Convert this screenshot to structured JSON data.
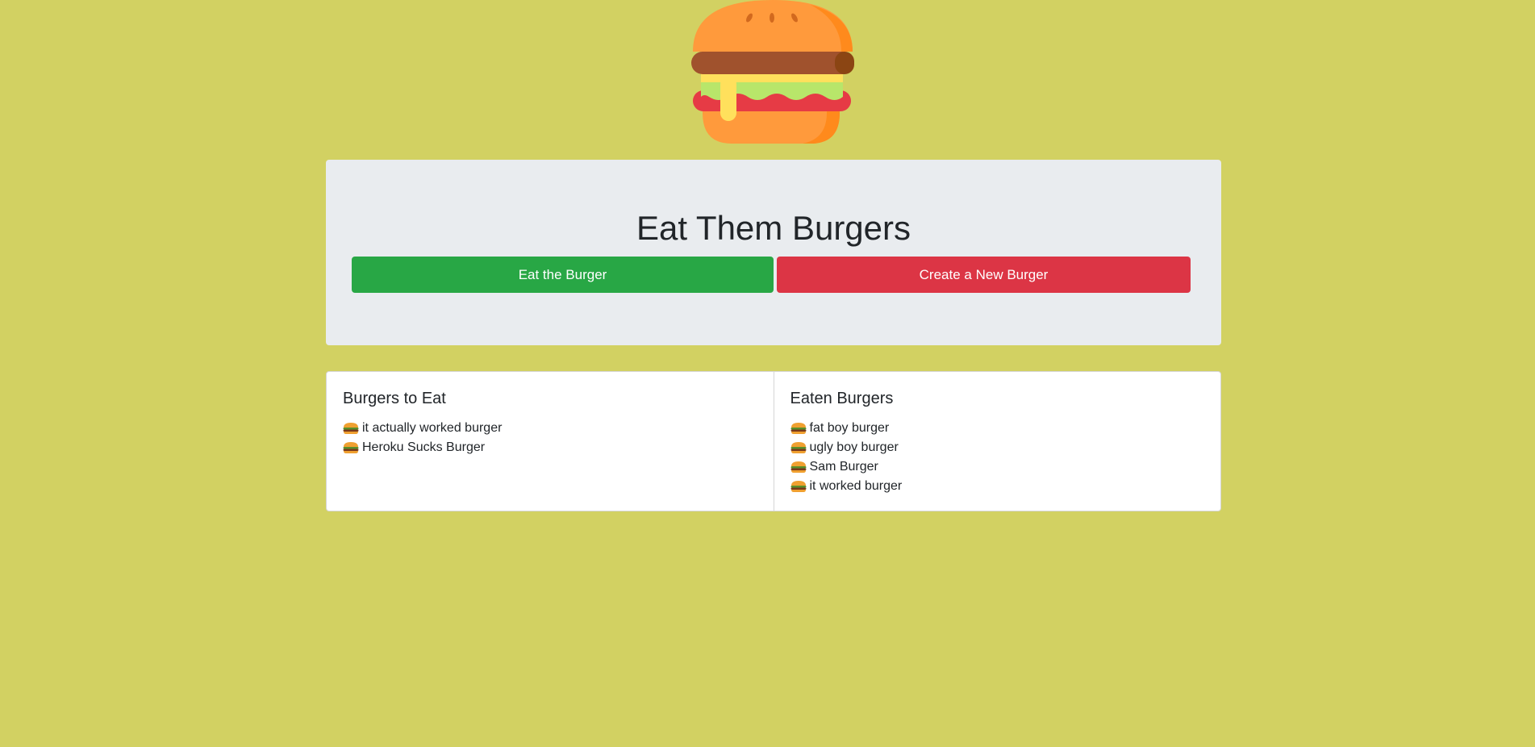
{
  "header": {
    "logo_icon": "burger-icon"
  },
  "jumbotron": {
    "title": "Eat Them Burgers",
    "eat_button_label": "Eat the Burger",
    "create_button_label": "Create a New Burger"
  },
  "colors": {
    "background": "#d2d162",
    "eat_button": "#28a745",
    "create_button": "#dc3545",
    "jumbotron": "#e9ecef"
  },
  "to_eat": {
    "title": "Burgers to Eat",
    "items": [
      {
        "icon": "burger-icon",
        "name": "it actually worked burger"
      },
      {
        "icon": "burger-icon",
        "name": "Heroku Sucks Burger"
      }
    ]
  },
  "eaten": {
    "title": "Eaten Burgers",
    "items": [
      {
        "icon": "burger-icon",
        "name": "fat boy burger"
      },
      {
        "icon": "burger-icon",
        "name": "ugly boy burger"
      },
      {
        "icon": "burger-icon",
        "name": "Sam Burger"
      },
      {
        "icon": "burger-icon",
        "name": "it worked burger"
      }
    ]
  }
}
